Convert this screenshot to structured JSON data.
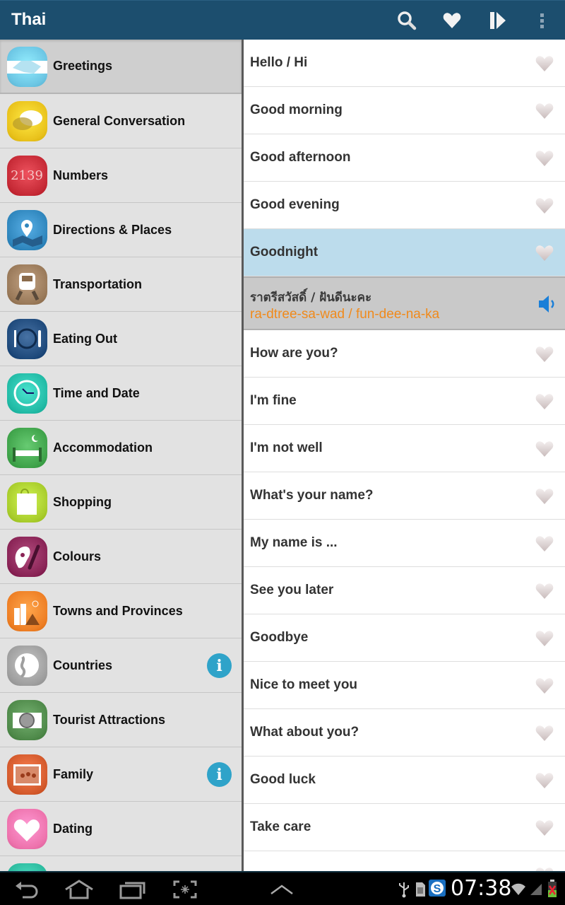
{
  "actionbar": {
    "title": "Thai",
    "icons": [
      "search-icon",
      "favorites-heart-icon",
      "play-icon",
      "overflow-menu-icon"
    ]
  },
  "colors": {
    "actionbar": "#1c4e6e",
    "selected_phrase": "#bcdcec",
    "romanization": "#f08a1c",
    "info_badge": "#2fa3c9"
  },
  "categories": [
    {
      "label": "Greetings",
      "icon": "handshake-icon",
      "color": "#6cc6e4",
      "selected": true,
      "info": false
    },
    {
      "label": "General Conversation",
      "icon": "speech-bubbles-icon",
      "color": "#e9c21c",
      "selected": false,
      "info": false
    },
    {
      "label": "Numbers",
      "icon": "numbers-icon",
      "color": "#c62a36",
      "selected": false,
      "info": false
    },
    {
      "label": "Directions & Places",
      "icon": "map-pin-icon",
      "color": "#2f86bd",
      "selected": false,
      "info": false
    },
    {
      "label": "Transportation",
      "icon": "train-icon",
      "color": "#9a7a5a",
      "selected": false,
      "info": false
    },
    {
      "label": "Eating Out",
      "icon": "plate-cutlery-icon",
      "color": "#1f4a7c",
      "selected": false,
      "info": false
    },
    {
      "label": "Time and Date",
      "icon": "clock-icon",
      "color": "#22bba6",
      "selected": false,
      "info": false
    },
    {
      "label": "Accommodation",
      "icon": "bed-icon",
      "color": "#3fa34a",
      "selected": false,
      "info": false
    },
    {
      "label": "Shopping",
      "icon": "shopping-bag-icon",
      "color": "#a9cd2c",
      "selected": false,
      "info": false
    },
    {
      "label": "Colours",
      "icon": "palette-icon",
      "color": "#8a2456",
      "selected": false,
      "info": false
    },
    {
      "label": "Towns and Provinces",
      "icon": "city-icon",
      "color": "#ee7f25",
      "selected": false,
      "info": false
    },
    {
      "label": "Countries",
      "icon": "globe-icon",
      "color": "#9f9f9f",
      "selected": false,
      "info": true
    },
    {
      "label": "Tourist Attractions",
      "icon": "camera-icon",
      "color": "#4f8a4a",
      "selected": false,
      "info": false
    },
    {
      "label": "Family",
      "icon": "family-portrait-icon",
      "color": "#d45a2c",
      "selected": false,
      "info": true
    },
    {
      "label": "Dating",
      "icon": "heart-icon",
      "color": "#ee73ad",
      "selected": false,
      "info": false
    },
    {
      "label": "",
      "icon": "category-icon",
      "color": "#2dbca0",
      "selected": false,
      "info": false
    }
  ],
  "info_badge_glyph": "i",
  "phrases": [
    {
      "label": "Hello / Hi"
    },
    {
      "label": "Good morning"
    },
    {
      "label": "Good afternoon"
    },
    {
      "label": "Good evening"
    },
    {
      "label": "Goodnight",
      "selected": true
    },
    {
      "label": "How are you?"
    },
    {
      "label": "I'm fine"
    },
    {
      "label": "I'm not well"
    },
    {
      "label": "What's your name?"
    },
    {
      "label": "My name is ..."
    },
    {
      "label": "See you later"
    },
    {
      "label": "Goodbye"
    },
    {
      "label": "Nice to meet you"
    },
    {
      "label": "What about you?"
    },
    {
      "label": "Good luck"
    },
    {
      "label": "Take care"
    },
    {
      "label": ""
    }
  ],
  "selected_detail": {
    "thai": "ราตรีสวัสดิ์ / ฝันดีนะคะ",
    "romanization": "ra-dtree-sa-wad / fun-dee-na-ka"
  },
  "navbar": {
    "buttons": [
      "back-icon",
      "home-icon",
      "recent-apps-icon",
      "screenshot-icon",
      "expand-up-icon"
    ],
    "clock": "07:38",
    "status_icons": [
      "usb-icon",
      "sd-card-icon",
      "s-app-icon",
      "wifi-icon",
      "signal-icon",
      "battery-icon"
    ]
  }
}
